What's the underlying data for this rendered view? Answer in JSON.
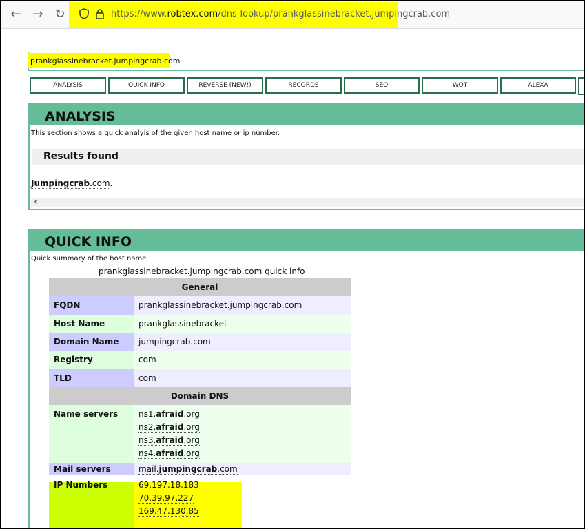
{
  "browser": {
    "url_prefix": "https://www.",
    "url_domain": "robtex.com",
    "url_path": "/dns-lookup/prankglassinebracket.jumpingcrab.com",
    "back_icon": "←",
    "forward_icon": "→",
    "reload_icon": "↻"
  },
  "search": {
    "value": "prankglassinebracket.jumpingcrab.com"
  },
  "tabs": [
    "ANALYSIS",
    "QUICK INFO",
    "REVERSE (NEW!)",
    "RECORDS",
    "SEO",
    "WOT",
    "ALEXA"
  ],
  "analysis": {
    "title": "ANALYSIS",
    "description": "This section shows a quick analyis of the given host name or ip number.",
    "results_label": "Results found",
    "result_bold": "Jumpingcrab",
    "result_rest": ".com",
    "result_end": "."
  },
  "quick_info": {
    "title": "QUICK INFO",
    "description": "Quick summary of the host name",
    "caption": "prankglassinebracket.jumpingcrab.com quick info",
    "general_header": "General",
    "fqdn_label": "FQDN",
    "fqdn_value": "prankglassinebracket.jumpingcrab.com",
    "hostname_label": "Host Name",
    "hostname_value": "prankglassinebracket",
    "domain_label": "Domain Name",
    "domain_value": "jumpingcrab.com",
    "registry_label": "Registry",
    "registry_value": "com",
    "tld_label": "TLD",
    "tld_value": "com",
    "dns_header": "Domain DNS",
    "ns_label": "Name servers",
    "name_servers": [
      {
        "pre": "ns1.",
        "bold": "afraid",
        "post": ".org"
      },
      {
        "pre": "ns2.",
        "bold": "afraid",
        "post": ".org"
      },
      {
        "pre": "ns3.",
        "bold": "afraid",
        "post": ".org"
      },
      {
        "pre": "ns4.",
        "bold": "afraid",
        "post": ".org"
      }
    ],
    "mail_label": "Mail servers",
    "mail_pre": "mail.",
    "mail_bold": "jumpingcrab",
    "mail_post": ".com",
    "ip_label": "IP Numbers",
    "ip_numbers": [
      "69.197.18.183",
      "70.39.97.227",
      "169.47.130.85"
    ]
  },
  "colors": {
    "section_header": "#64bc99",
    "highlight": "#fefe00",
    "ip_highlight": "#ccff00"
  }
}
